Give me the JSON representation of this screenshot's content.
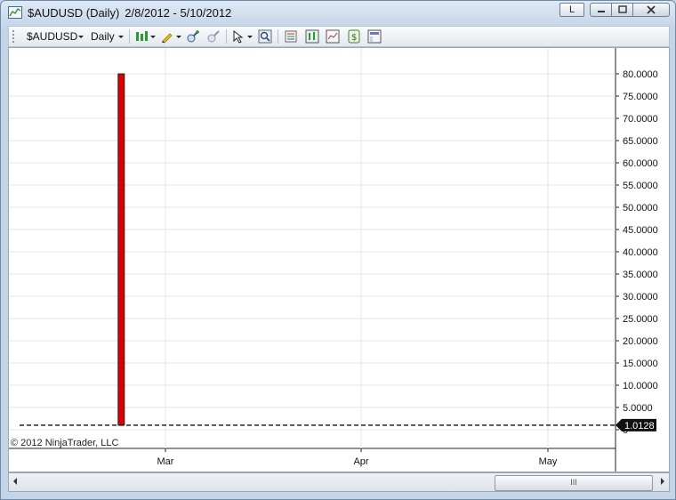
{
  "window": {
    "title_symbol": "$AUDUSD (Daily)",
    "title_range": "2/8/2012 - 5/10/2012",
    "l_label": "L"
  },
  "toolbar": {
    "instrument": "$AUDUSD",
    "interval": "Daily",
    "icons": [
      "bar-type-icon",
      "drawing-pencil-icon",
      "zoom-in-icon",
      "zoom-out-icon",
      "cursor-icon",
      "search-icon",
      "properties-icon",
      "strategies-icon",
      "indicators-icon",
      "data-box-icon",
      "chart-trader-icon"
    ]
  },
  "chart_data": {
    "type": "bar",
    "instrument": "$AUDUSD",
    "interval": "Daily",
    "range": "2/8/2012 - 5/10/2012",
    "x_ticks": [
      "Mar",
      "Apr",
      "May"
    ],
    "y_ticks": [
      "80.0000",
      "75.0000",
      "70.0000",
      "65.0000",
      "60.0000",
      "55.0000",
      "50.0000",
      "45.0000",
      "40.0000",
      "35.0000",
      "30.0000",
      "25.0000",
      "20.0000",
      "15.0000",
      "10.0000",
      "5.0000",
      "0"
    ],
    "ylim": [
      0,
      80
    ],
    "spike_bar": {
      "date_approx": "2/23/2012",
      "low": 1.0128,
      "high": 80.0
    },
    "last_price": 1.0128,
    "last_price_label": "1.0128",
    "grid": true,
    "bar_color": "#dd0000"
  },
  "footer": {
    "copyright": "© 2012 NinjaTrader, LLC"
  },
  "scrollbar": {
    "thumb_label": "III"
  }
}
